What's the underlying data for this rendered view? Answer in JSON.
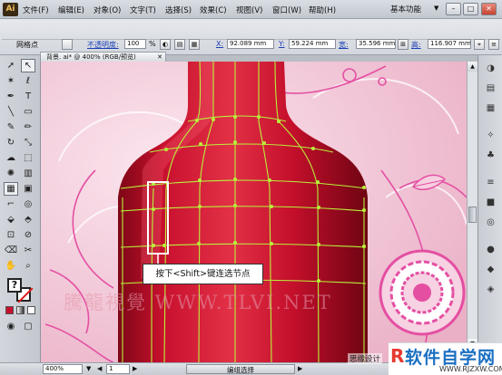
{
  "app": {
    "logo": "Ai",
    "workspace": "基本功能"
  },
  "menu": [
    "文件(F)",
    "编辑(E)",
    "对象(O)",
    "文字(T)",
    "选择(S)",
    "效果(C)",
    "视图(V)",
    "窗口(W)",
    "帮助(H)"
  ],
  "window_buttons": {
    "minimize": "–",
    "restore": "□",
    "close": "✕"
  },
  "controlbar": {
    "mode_label": "网格点",
    "opacity_label": "不透明度:",
    "opacity_value": "100",
    "opacity_unit": "%",
    "x_label": "X:",
    "x_value": "92.089 mm",
    "y_label": "Y:",
    "y_value": "59.224 mm",
    "w_label": "宽:",
    "w_value": "35.596 mm",
    "h_label": "高:",
    "h_value": "116.907 mm"
  },
  "document_tab": {
    "title": "背景. ai* @ 400% (RGB/预览)",
    "close": "✕"
  },
  "callout": {
    "text": "按下<Shift>键连选节点"
  },
  "watermark": {
    "text": "騰龍視覺 WWW.TLVI.NET"
  },
  "statusbar": {
    "zoom": "400%",
    "page": "1",
    "tool": "编组选择"
  },
  "footer": {
    "credit": "思缘设计",
    "brand_name": "软件自学网",
    "brand_url": "WWW.RJZXW.COM"
  },
  "colors": {
    "bottle_red": "#c8102e",
    "mesh_line": "#b9f23a",
    "background_pink": "#f1c6d6",
    "flower_pink": "#e44fa2"
  },
  "icons": {
    "tools": [
      "selection-tool-icon",
      "direct-selection-tool-icon",
      "magic-wand-icon",
      "lasso-icon",
      "pen-icon",
      "type-icon",
      "line-icon",
      "rectangle-icon",
      "paintbrush-icon",
      "pencil-icon",
      "rotate-icon",
      "scale-icon",
      "warp-icon",
      "free-transform-icon",
      "symbol-sprayer-icon",
      "graph-icon",
      "mesh-icon",
      "gradient-icon",
      "eyedropper-icon",
      "blend-icon",
      "live-paint-icon",
      "live-paint-select-icon",
      "artboard-icon",
      "slice-icon",
      "eraser-icon",
      "scissors-icon",
      "hand-icon",
      "zoom-icon"
    ],
    "right_panel": [
      "color-panel-icon",
      "guide-panel-icon",
      "swatches-panel-icon",
      "brushes-panel-icon",
      "symbols-panel-icon",
      "stroke-panel-icon",
      "gradient-panel-icon",
      "transparency-panel-icon",
      "appearance-panel-icon",
      "graphic-styles-panel-icon",
      "layers-panel-icon"
    ]
  }
}
